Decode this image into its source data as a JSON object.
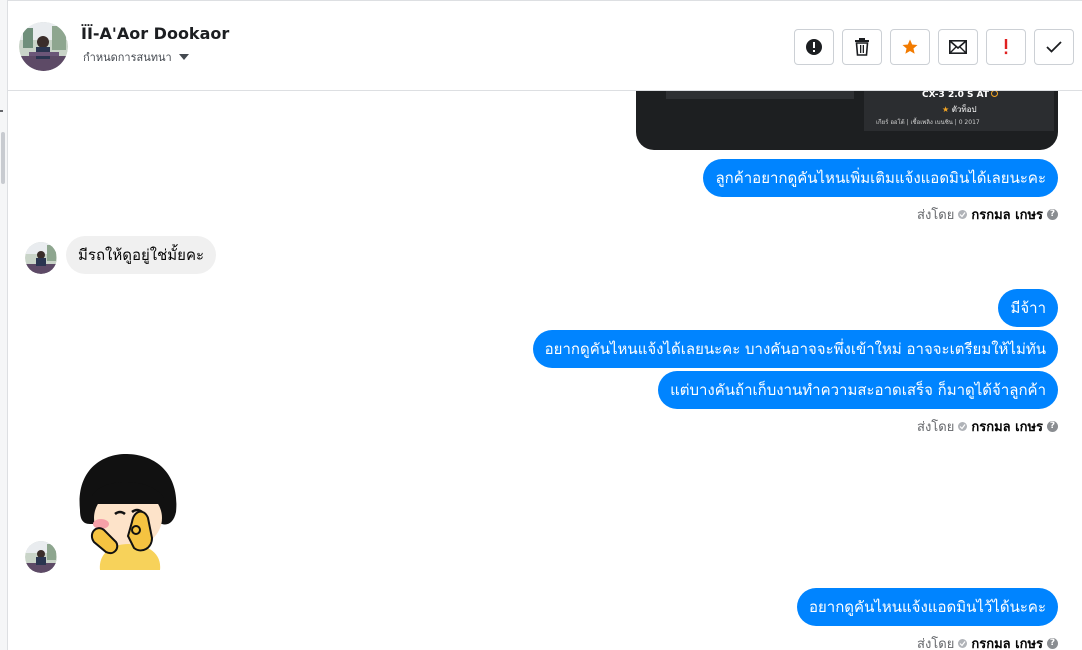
{
  "header": {
    "contact_name": "ÏÏ-A'Aor Dookaor",
    "subtitle": "กำหนดการสนทนา",
    "actions": [
      {
        "name": "report-spam-button",
        "icon": "alert-circle-icon"
      },
      {
        "name": "delete-button",
        "icon": "trash-icon"
      },
      {
        "name": "star-button",
        "icon": "star-icon"
      },
      {
        "name": "mark-unread-button",
        "icon": "envelope-icon"
      },
      {
        "name": "follow-up-button",
        "icon": "exclamation-icon"
      },
      {
        "name": "mark-done-button",
        "icon": "check-icon"
      }
    ]
  },
  "shared_card": {
    "model": "CX-3 2.0 S AT",
    "badge": "ตัวท็อป",
    "specs": "เกียร์ ออโต้ | เชื้อเพลิง เบนซิน | 0 2017"
  },
  "messages": [
    {
      "side": "out",
      "text": "ลูกค้าอยากดูคันไหนเพิ่มเติมแจ้งแอดมินได้เลยนะคะ"
    },
    {
      "side": "in",
      "text": "มีรถให้ดูอยู่ใช่มั้ยคะ"
    },
    {
      "side": "out",
      "text": "มีจ้าา"
    },
    {
      "side": "out",
      "text": "อยากดูคันไหนแจ้งได้เลยนะคะ  บางคันอาจจะพึ่งเข้าใหม่ อาจจะเตรียมให้ไม่ทัน"
    },
    {
      "side": "out",
      "text": "แต่บางคันถ้าเก็บงานทำความสะอาดเสร็จ ก็มาดูได้จ้าลูกค้า"
    },
    {
      "side": "out",
      "text": "อยากดูคันไหนแจ้งแอดมินไว้ได้นะคะ"
    }
  ],
  "sent_by": {
    "prefix": "ส่งโดย",
    "name": "กรกมล เกษร",
    "help": "?"
  },
  "colors": {
    "outgoing_bubble": "#0084ff",
    "incoming_bubble": "#f0f0f0",
    "star": "#f27b00",
    "follow_up": "#e02020"
  }
}
